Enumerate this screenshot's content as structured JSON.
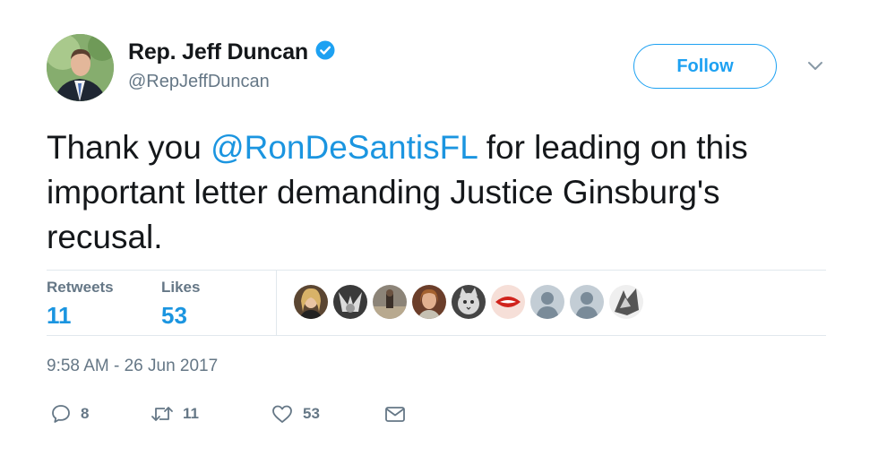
{
  "author": {
    "display_name": "Rep. Jeff Duncan",
    "handle": "@RepJeffDuncan",
    "verified": true,
    "avatar_icon": "profile-photo"
  },
  "follow_label": "Follow",
  "tweet": {
    "text_before": "Thank you ",
    "mention": "@RonDeSantisFL",
    "text_after": " for leading on this important letter demanding Justice Ginsburg's recusal."
  },
  "stats": {
    "retweets_label": "Retweets",
    "retweets_count": "11",
    "likes_label": "Likes",
    "likes_count": "53"
  },
  "likers": [
    {
      "icon": "liker-avatar-1"
    },
    {
      "icon": "liker-avatar-2"
    },
    {
      "icon": "liker-avatar-3"
    },
    {
      "icon": "liker-avatar-4"
    },
    {
      "icon": "liker-avatar-5"
    },
    {
      "icon": "liker-avatar-6"
    },
    {
      "icon": "default-avatar"
    },
    {
      "icon": "default-avatar"
    },
    {
      "icon": "liker-avatar-9"
    }
  ],
  "timestamp": "9:58 AM - 26 Jun 2017",
  "actions": {
    "reply_count": "8",
    "retweet_count": "11",
    "like_count": "53"
  },
  "colors": {
    "accent": "#1da1f2",
    "link": "#1b95e0",
    "secondary_text": "#657786",
    "divider": "#e1e8ed"
  }
}
